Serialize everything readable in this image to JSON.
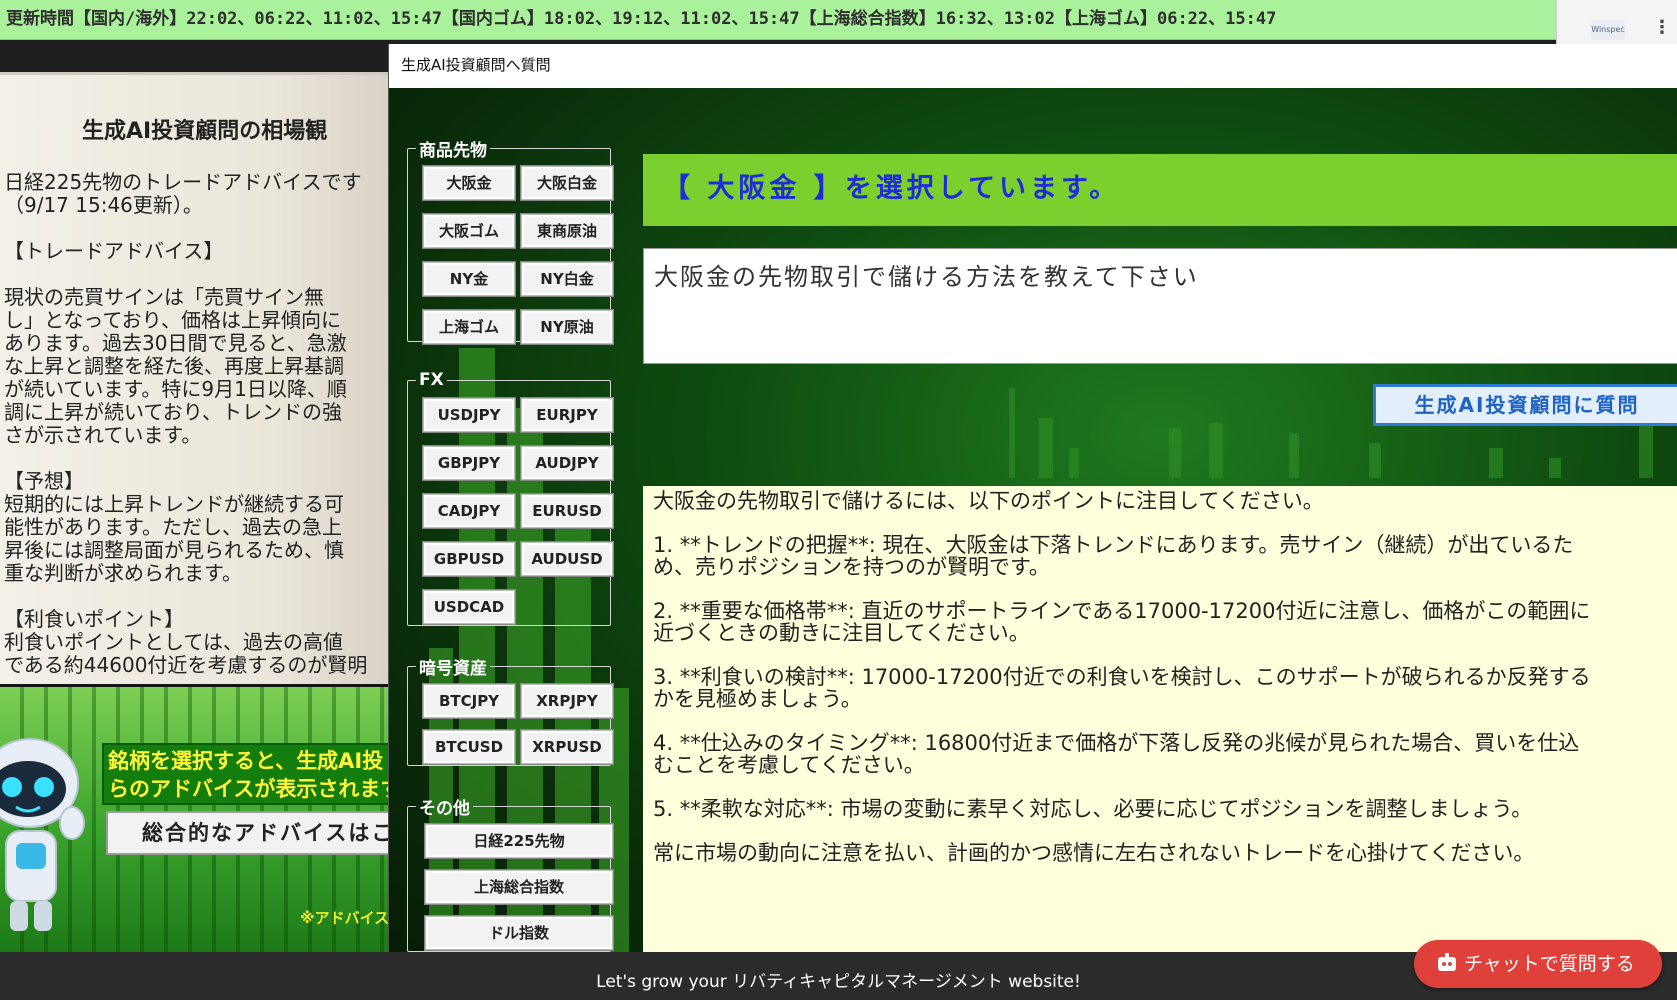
{
  "ticker": {
    "text": "更新時間【国内/海外】22:02、06:22、11:02、15:47【国内ゴム】18:02、19:12、11:02、15:47【上海総合指数】16:32、13:02【上海ゴム】06:22、15:47"
  },
  "right_thumb": {
    "logo_text": "Winspec"
  },
  "left_page": {
    "title": "生成AI投資顧問の相場観",
    "body": "日経225先物のトレードアドバイスです\n（9/17 15:46更新）。\n\n【トレードアドバイス】\n\n現状の売買サインは「売買サイン無\nし」となっており、価格は上昇傾向に\nあります。過去30日間で見ると、急激\nな上昇と調整を経た後、再度上昇基調\nが続いています。特に9月1日以降、順\n調に上昇が続いており、トレンドの強\nさが示されています。\n\n【予想】\n短期的には上昇トレンドが継続する可\n能性があります。ただし、過去の急上\n昇後には調整局面が見られるため、慎\n重な判断が求められます。\n\n【利食いポイント】\n利食いポイントとしては、過去の高値\nである約44600付近を考慮するのが賢明",
    "banner": "銘柄を選択すると、生成AI投\nらのアドバイスが表示されます。",
    "overall_button": "総合的なアドバイスはこ",
    "note": "※アドバイス"
  },
  "dialog": {
    "title": "生成AI投資顧問へ質問",
    "groups": {
      "commodities": {
        "legend": "商品先物",
        "buttons": [
          "大阪金",
          "大阪白金",
          "大阪ゴム",
          "東商原油",
          "NY金",
          "NY白金",
          "上海ゴム",
          "NY原油"
        ]
      },
      "fx": {
        "legend": "FX",
        "buttons": [
          "USDJPY",
          "EURJPY",
          "GBPJPY",
          "AUDJPY",
          "CADJPY",
          "EURUSD",
          "GBPUSD",
          "AUDUSD",
          "USDCAD"
        ]
      },
      "crypto": {
        "legend": "暗号資産",
        "buttons": [
          "BTCJPY",
          "XRPJPY",
          "BTCUSD",
          "XRPUSD"
        ]
      },
      "other": {
        "legend": "その他",
        "buttons": [
          "日経225先物",
          "上海総合指数",
          "ドル指数"
        ]
      }
    },
    "selected_banner": "【 大阪金 】を選択しています。",
    "question_value": "大阪金の先物取引で儲ける方法を教えて下さい",
    "ask_button": "生成AI投資顧問に質問",
    "answer": "大阪金の先物取引で儲けるには、以下のポイントに注目してください。\n\n1. **トレンドの把握**: 現在、大阪金は下落トレンドにあります。売サイン（継続）が出ているた\nめ、売りポジションを持つのが賢明です。\n\n2. **重要な価格帯**: 直近のサポートラインである17000-17200付近に注意し、価格がこの範囲に\n近づくときの動きに注目してください。\n\n3. **利食いの検討**: 17000-17200付近での利食いを検討し、このサポートが破られるか反発する\nかを見極めましょう。\n\n4. **仕込みのタイミング**: 16800付近まで価格が下落し反発の兆候が見られた場合、買いを仕込\nむことを考慮してください。\n\n5. **柔軟な対応**: 市場の変動に素早く対応し、必要に応じてポジションを調整しましょう。\n\n常に市場の動向に注意を払い、計画的かつ感情に左右されないトレードを心掛けてください。"
  },
  "footer": {
    "text": "Let's grow your リバティキャピタルマネージメント website!",
    "chat_button": "チャットで質問する"
  },
  "colors": {
    "ticker_bg": "#a9f29b",
    "banner_green": "#7bd02e",
    "banner_text_blue": "#1f2bd8",
    "answer_bg": "#ffffdc",
    "chat_red": "#e0403a"
  }
}
